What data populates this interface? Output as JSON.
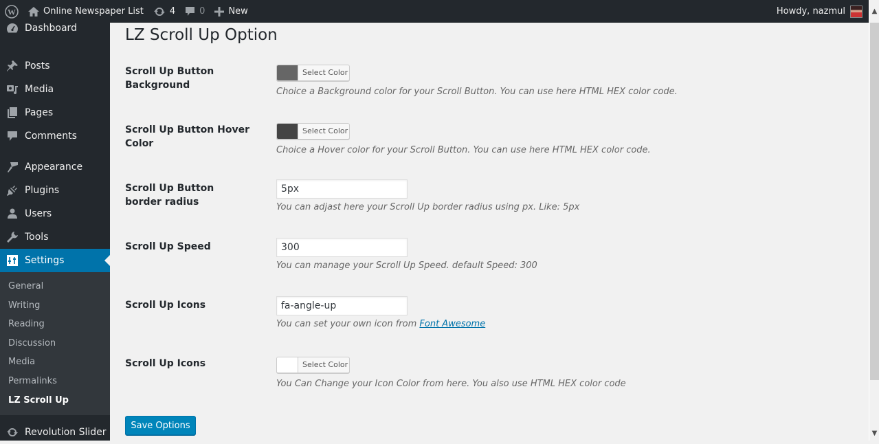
{
  "admin_bar": {
    "site_name": "Online Newspaper List",
    "updates_count": "4",
    "comments_count": "0",
    "new_label": "New",
    "greeting": "Howdy, nazmul"
  },
  "sidebar": {
    "items": [
      {
        "label": "Dashboard",
        "icon": "dashboard-icon"
      },
      {
        "label": "Posts",
        "icon": "pin-icon"
      },
      {
        "label": "Media",
        "icon": "media-icon"
      },
      {
        "label": "Pages",
        "icon": "pages-icon"
      },
      {
        "label": "Comments",
        "icon": "comment-icon"
      },
      {
        "label": "Appearance",
        "icon": "brush-icon"
      },
      {
        "label": "Plugins",
        "icon": "plug-icon"
      },
      {
        "label": "Users",
        "icon": "user-icon"
      },
      {
        "label": "Tools",
        "icon": "wrench-icon"
      },
      {
        "label": "Settings",
        "icon": "settings-icon"
      },
      {
        "label": "Revolution Slider",
        "icon": "refresh-icon"
      }
    ],
    "submenu": [
      "General",
      "Writing",
      "Reading",
      "Discussion",
      "Media",
      "Permalinks",
      "LZ Scroll Up"
    ]
  },
  "page": {
    "title": "LZ Scroll Up Option",
    "fields": [
      {
        "label": "Scroll Up Button Background",
        "type": "color",
        "swatch": "#666666",
        "button": "Select Color",
        "description": "Choice a Background color for your Scroll Button. You can use here HTML HEX color code."
      },
      {
        "label": "Scroll Up Button Hover Color",
        "type": "color",
        "swatch": "#444444",
        "button": "Select Color",
        "description": "Choice a Hover color for your Scroll Button. You can use here HTML HEX color code."
      },
      {
        "label": "Scroll Up Button border radius",
        "type": "text",
        "value": "5px",
        "description": "You can adjast here your Scroll Up border radius using px. Like: 5px"
      },
      {
        "label": "Scroll Up Speed",
        "type": "text",
        "value": "300",
        "description": "You can manage your Scroll Up Speed. default Speed: 300"
      },
      {
        "label": "Scroll Up Icons",
        "type": "text",
        "value": "fa-angle-up",
        "description": "You can set your own icon from ",
        "link": "Font Awesome"
      },
      {
        "label": "Scroll Up Icons",
        "type": "color",
        "swatch": "#ffffff",
        "button": "Select Color",
        "description": "You Can Change your Icon Color from here. You also use HTML HEX color code"
      }
    ],
    "save_label": "Save Options"
  },
  "colors": {
    "admin_bar_bg": "#23282d",
    "accent": "#0073aa",
    "primary_button": "#0085ba"
  }
}
